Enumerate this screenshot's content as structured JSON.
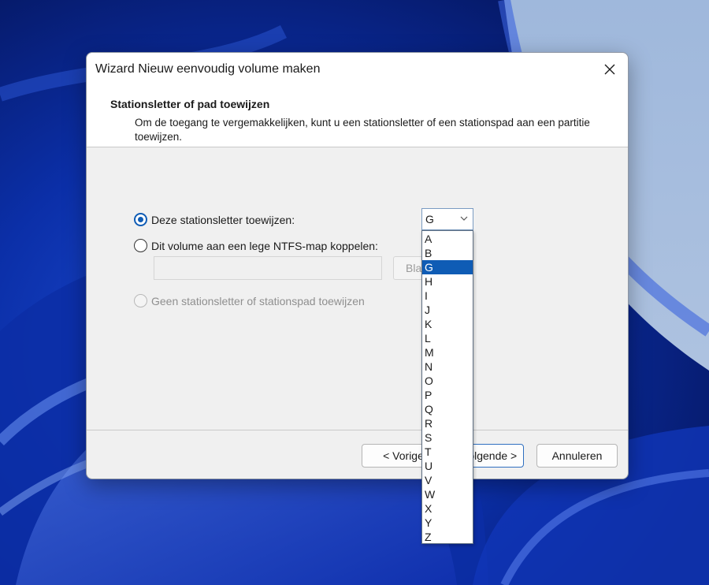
{
  "window": {
    "title": "Wizard Nieuw eenvoudig volume maken",
    "close_icon": "close-icon"
  },
  "header": {
    "title": "Stationsletter of pad toewijzen",
    "description": "Om de toegang te vergemakkelijken, kunt u een stationsletter of een stationspad aan een partitie toewijzen."
  },
  "options": {
    "assign_letter": {
      "label": "Deze stationsletter toewijzen:",
      "checked": true
    },
    "mount_folder": {
      "label": "Dit volume aan een lege NTFS-map koppelen:",
      "checked": false
    },
    "no_letter": {
      "label": "Geen stationsletter of stationspad toewijzen",
      "checked": false,
      "disabled": true
    }
  },
  "path_input": {
    "value": ""
  },
  "browse_button": {
    "label": "Bla"
  },
  "drive_letter": {
    "selected": "G",
    "options": [
      "A",
      "B",
      "G",
      "H",
      "I",
      "J",
      "K",
      "L",
      "M",
      "N",
      "O",
      "P",
      "Q",
      "R",
      "S",
      "T",
      "U",
      "V",
      "W",
      "X",
      "Y",
      "Z"
    ]
  },
  "footer": {
    "back_label": "< Vorige",
    "next_label": "Volgende >",
    "cancel_label": "Annuleren"
  },
  "colors": {
    "accent": "#0f5cb5",
    "selection_text": "#ffffff"
  }
}
